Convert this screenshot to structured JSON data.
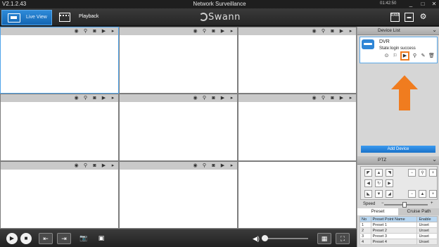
{
  "app": {
    "version": "V2.1.2.43",
    "window_title": "Network Surveillance",
    "clock": "01:42:50",
    "logo_text": "Swann"
  },
  "header": {
    "tabs": [
      {
        "label": "Live View",
        "active": true
      },
      {
        "label": "Playback",
        "active": false
      }
    ],
    "icons": [
      "ram-icon",
      "screen-icon",
      "gear-icon"
    ],
    "ram_label": "RAM"
  },
  "grid": {
    "cells": [
      {
        "active": true
      },
      {
        "active": false
      },
      {
        "active": false
      },
      {
        "active": false
      },
      {
        "active": false
      },
      {
        "active": false
      },
      {
        "active": false
      },
      {
        "active": false
      },
      {
        "active": false
      }
    ],
    "cell_icons": [
      "record-icon",
      "zoom-icon",
      "snapshot-icon",
      "video-icon",
      "play-icon"
    ]
  },
  "device_panel": {
    "title": "Device List",
    "device": {
      "name": "DVR",
      "state": "State:login success"
    },
    "add_button": "Add Device"
  },
  "ptz": {
    "title": "PTZ",
    "speed_label": "Speed",
    "tabs": [
      "Preset",
      "Cruise Path"
    ],
    "columns": [
      "No",
      "Preset Point Name",
      "Enable"
    ],
    "rows": [
      [
        "1",
        "Preset 1",
        "Unset"
      ],
      [
        "2",
        "Preset 2",
        "Unset"
      ],
      [
        "3",
        "Preset 3",
        "Unset"
      ],
      [
        "4",
        "Preset 4",
        "Unset"
      ]
    ]
  },
  "colors": {
    "accent": "#1f7ad0",
    "highlight": "#f07c1f"
  }
}
